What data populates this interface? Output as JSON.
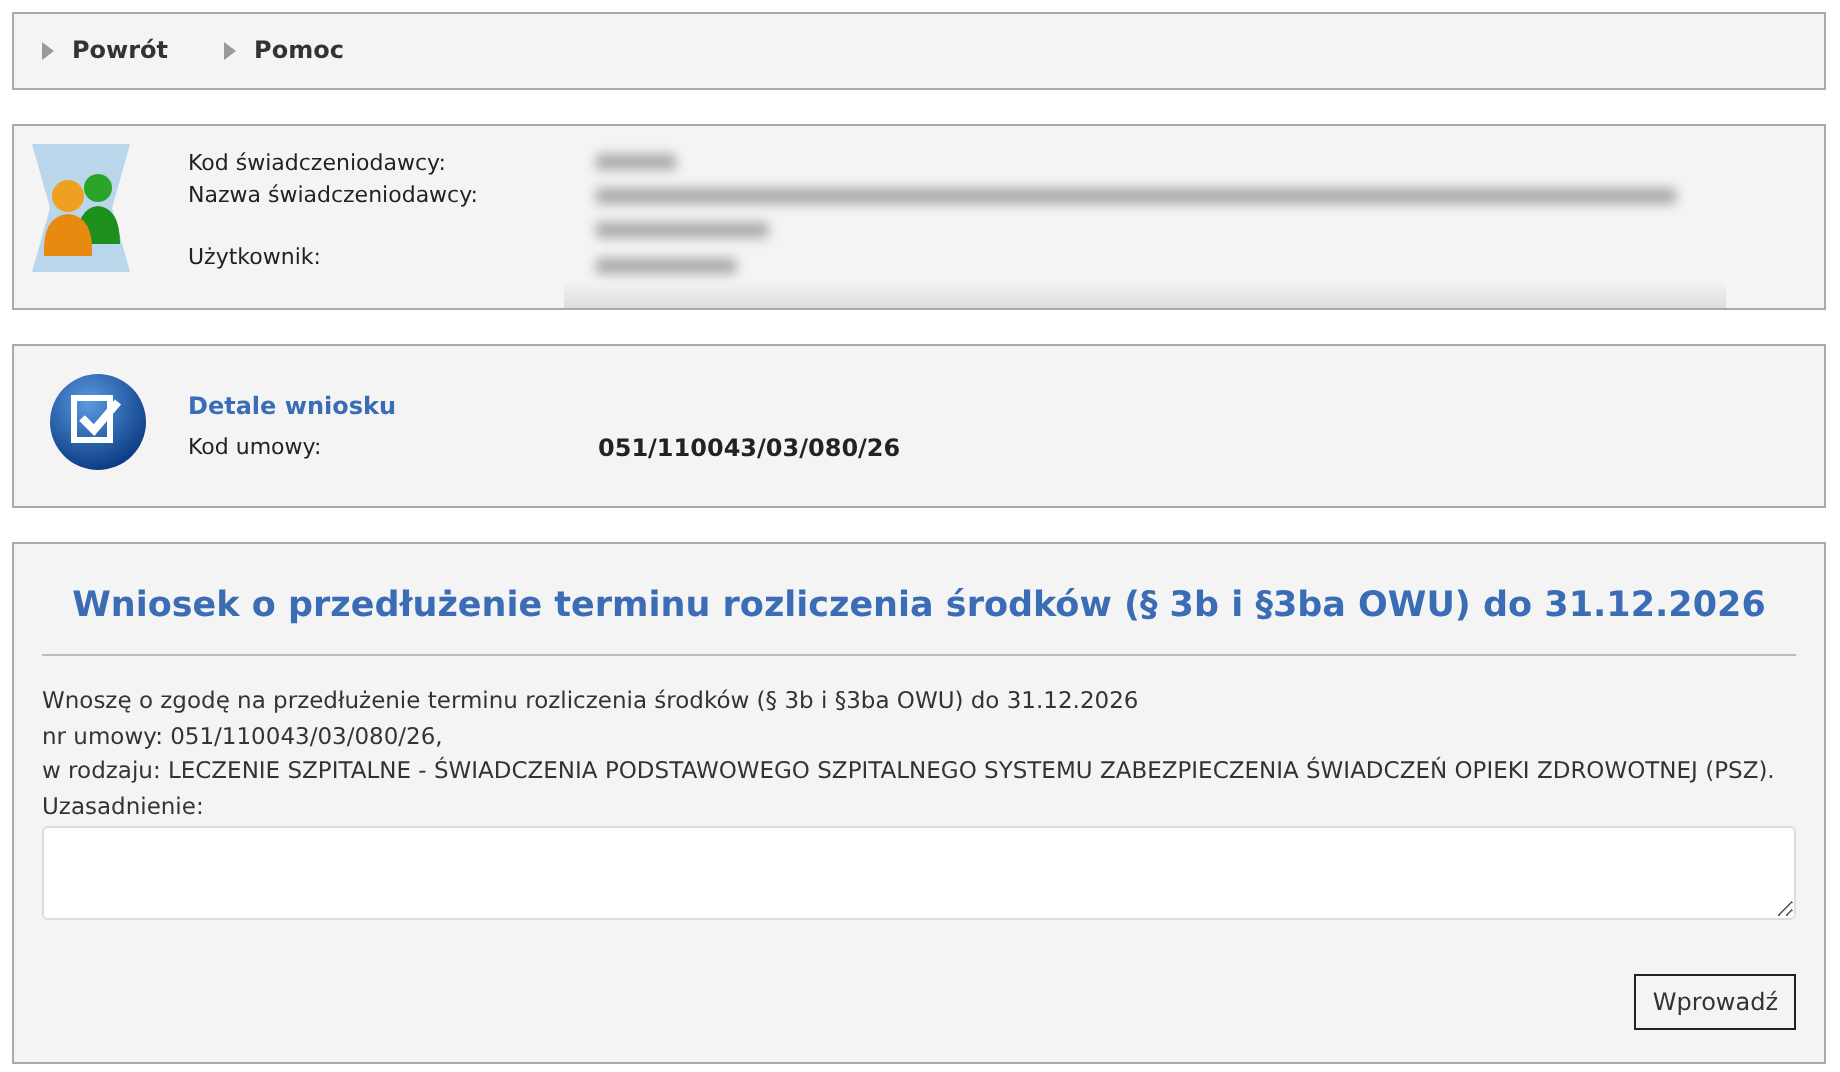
{
  "nav": [
    {
      "label": "Powrót"
    },
    {
      "label": "Pomoc"
    }
  ],
  "provider": {
    "labels": [
      "Kod świadczeniodawcy:",
      "Nazwa świadczeniodawcy:",
      "Użytkownik:"
    ]
  },
  "details": {
    "title": "Detale wniosku",
    "label": "Kod umowy:",
    "value": "051/110043/03/080/26"
  },
  "request": {
    "title": "Wniosek o przedłużenie terminu rozliczenia środków (§ 3b i §3ba OWU) do 31.12.2026",
    "lines": [
      "Wnoszę o zgodę na przedłużenie terminu rozliczenia środków (§ 3b i §3ba OWU) do 31.12.2026",
      "nr umowy: 051/110043/03/080/26,",
      "w rodzaju: LECZENIE SZPITALNE - ŚWIADCZENIA PODSTAWOWEGO SZPITALNEGO SYSTEMU ZABEZPIECZENIA ŚWIADCZEŃ OPIEKI ZDROWOTNEJ (PSZ).",
      "Uzasadnienie:"
    ],
    "submit": "Wprowadź"
  }
}
